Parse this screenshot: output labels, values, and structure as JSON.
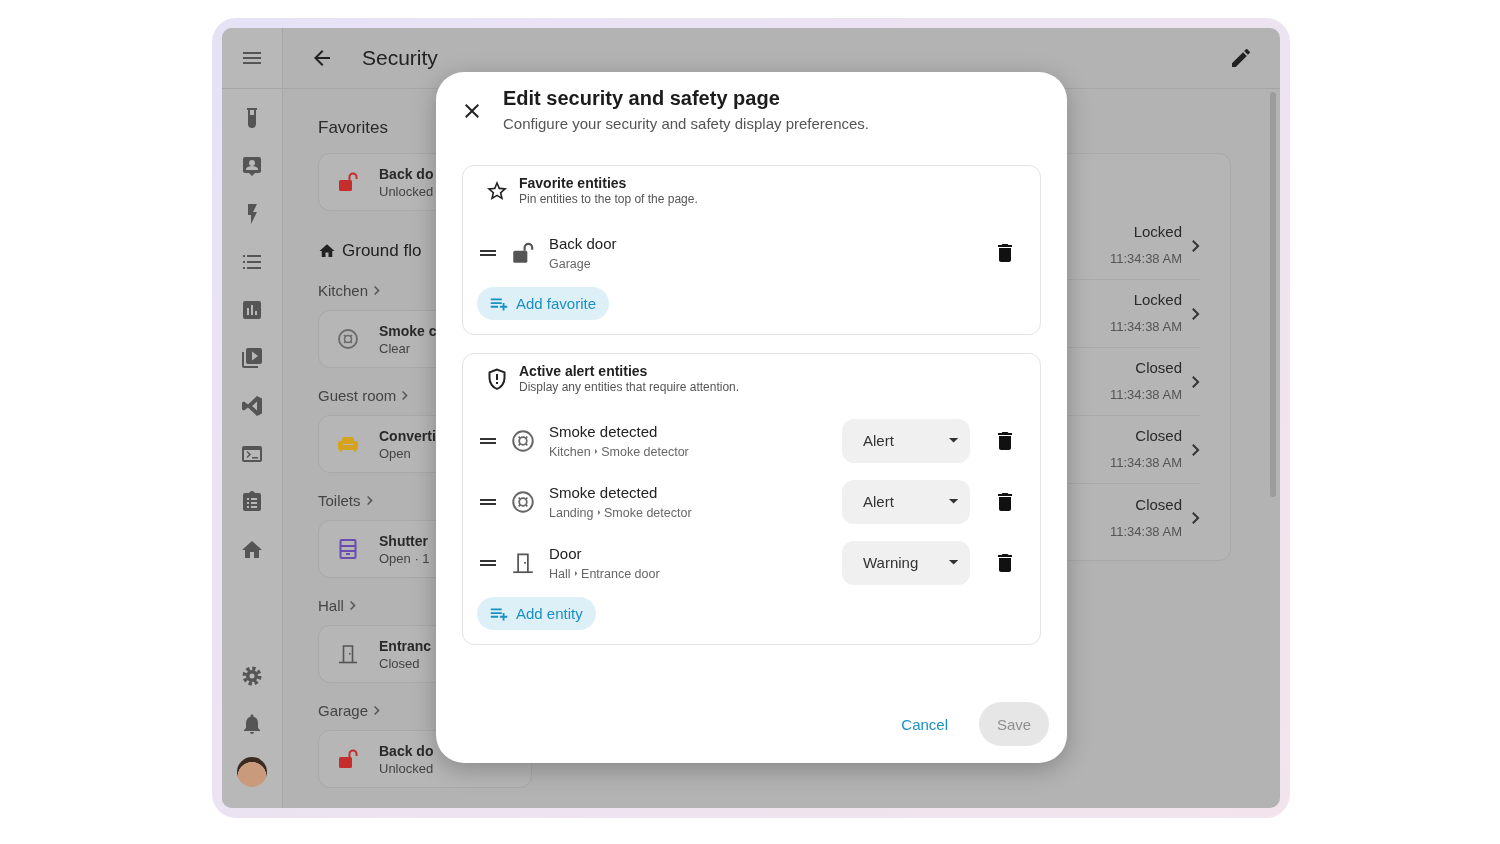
{
  "top_bar": {
    "title": "Security"
  },
  "favorites": {
    "heading": "Favorites",
    "entities": [
      {
        "kind": "lock",
        "name": "Back do",
        "state": "Unlocked"
      }
    ]
  },
  "floor": {
    "name": "Ground flo",
    "areas": [
      {
        "name": "Kitchen",
        "entities": [
          {
            "kind": "smoke",
            "name": "Smoke c",
            "state": "Clear"
          }
        ]
      },
      {
        "name": "Guest room",
        "entities": [
          {
            "kind": "sofa",
            "name": "Converti",
            "state": "Open"
          }
        ]
      },
      {
        "name": "Toilets",
        "entities": [
          {
            "kind": "shutter",
            "name": "Shutter",
            "state": "Open · 1"
          }
        ]
      },
      {
        "name": "Hall",
        "entities": [
          {
            "kind": "door",
            "name": "Entranc",
            "state": "Closed"
          }
        ]
      },
      {
        "name": "Garage",
        "entities": [
          {
            "kind": "lock",
            "name": "Back do",
            "state": "Unlocked"
          }
        ]
      }
    ]
  },
  "recent": {
    "rows": [
      {
        "state": "Locked",
        "time": "11:34:38 AM"
      },
      {
        "state": "Locked",
        "time": "11:34:38 AM"
      },
      {
        "state": "Closed",
        "time": "11:34:38 AM"
      },
      {
        "state": "Closed",
        "time": "11:34:38 AM"
      },
      {
        "state": "Closed",
        "time": "11:34:38 AM"
      }
    ]
  },
  "dialog": {
    "title": "Edit security and safety page",
    "subtitle": "Configure your security and safety display preferences.",
    "sections": [
      {
        "kind": "favorites",
        "title": "Favorite entities",
        "description": "Pin entities to the top of the page.",
        "add_label": "Add favorite",
        "entities": [
          {
            "kind": "lock",
            "name": "Back door",
            "path": [
              "Garage"
            ]
          }
        ]
      },
      {
        "kind": "alerts",
        "title": "Active alert entities",
        "description": "Display any entities that require attention.",
        "add_label": "Add entity",
        "entities": [
          {
            "kind": "smoke",
            "name": "Smoke detected",
            "path": [
              "Kitchen",
              "Smoke detector"
            ],
            "severity": "Alert"
          },
          {
            "kind": "smoke",
            "name": "Smoke detected",
            "path": [
              "Landing",
              "Smoke detector"
            ],
            "severity": "Alert"
          },
          {
            "kind": "door",
            "name": "Door",
            "path": [
              "Hall",
              "Entrance door"
            ],
            "severity": "Warning"
          }
        ]
      }
    ],
    "actions": {
      "cancel": "Cancel",
      "save": {
        "label": "Save",
        "disabled": true
      }
    }
  }
}
